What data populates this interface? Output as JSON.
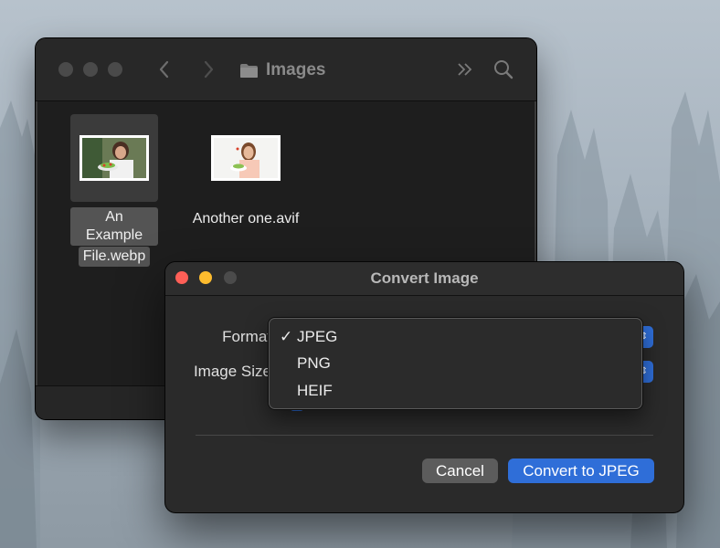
{
  "finder": {
    "title": "Images",
    "files": [
      {
        "name_line1": "An Example",
        "name_line2": "File.webp",
        "selected": true
      },
      {
        "name": "Another one.avif",
        "selected": false
      }
    ]
  },
  "dialog": {
    "title": "Convert Image",
    "format_label": "Format",
    "size_label": "Image Size",
    "cancel_label": "Cancel",
    "convert_label": "Convert to JPEG"
  },
  "format_menu": {
    "items": [
      {
        "check": "✓",
        "label": "JPEG"
      },
      {
        "check": "",
        "label": "PNG"
      },
      {
        "check": "",
        "label": "HEIF"
      }
    ]
  },
  "colors": {
    "accent": "#2f6ed8",
    "close": "#ff5f57",
    "minimize": "#febc2e"
  }
}
